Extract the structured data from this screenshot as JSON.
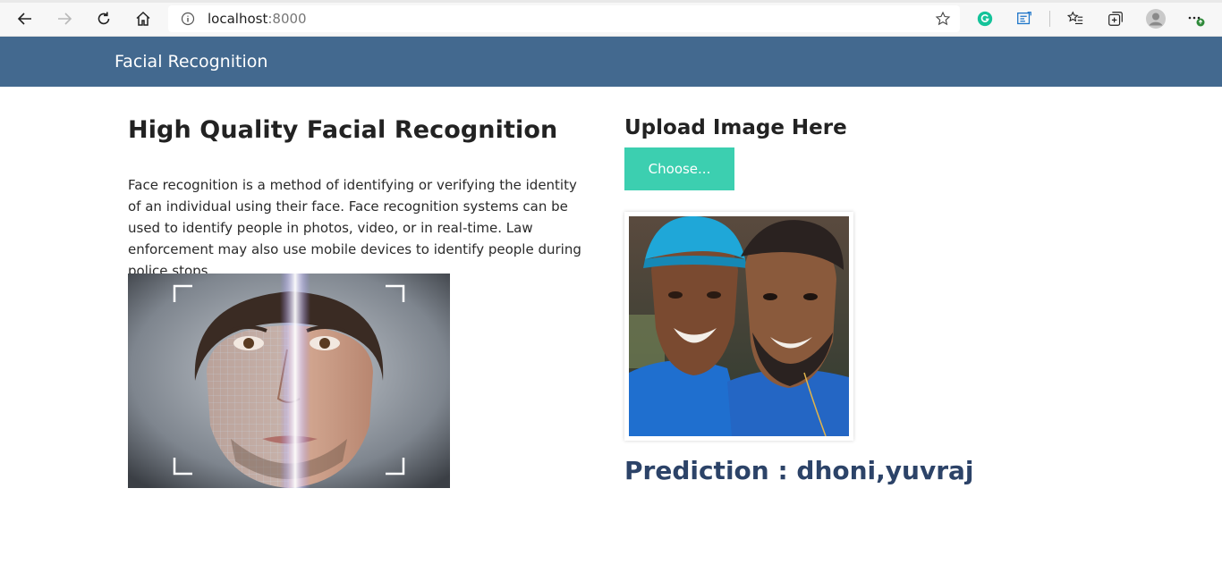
{
  "browser": {
    "address_host": "localhost",
    "address_port": ":8000"
  },
  "navbar": {
    "brand": "Facial Recognition"
  },
  "intro": {
    "title": "High Quality Facial Recognition",
    "description": "Face recognition is a method of identifying or verifying the identity of an individual using their face. Face recognition systems can be used to identify people in photos, video, or in real-time. Law enforcement may also use mobile devices to identify people during police stops."
  },
  "upload": {
    "title": "Upload Image Here",
    "button_label": "Choose..."
  },
  "result": {
    "prediction": "Prediction : dhoni,yuvraj"
  },
  "colors": {
    "navbar": "#43698f",
    "button": "#3ccfb0",
    "prediction_text": "#2c4368"
  }
}
